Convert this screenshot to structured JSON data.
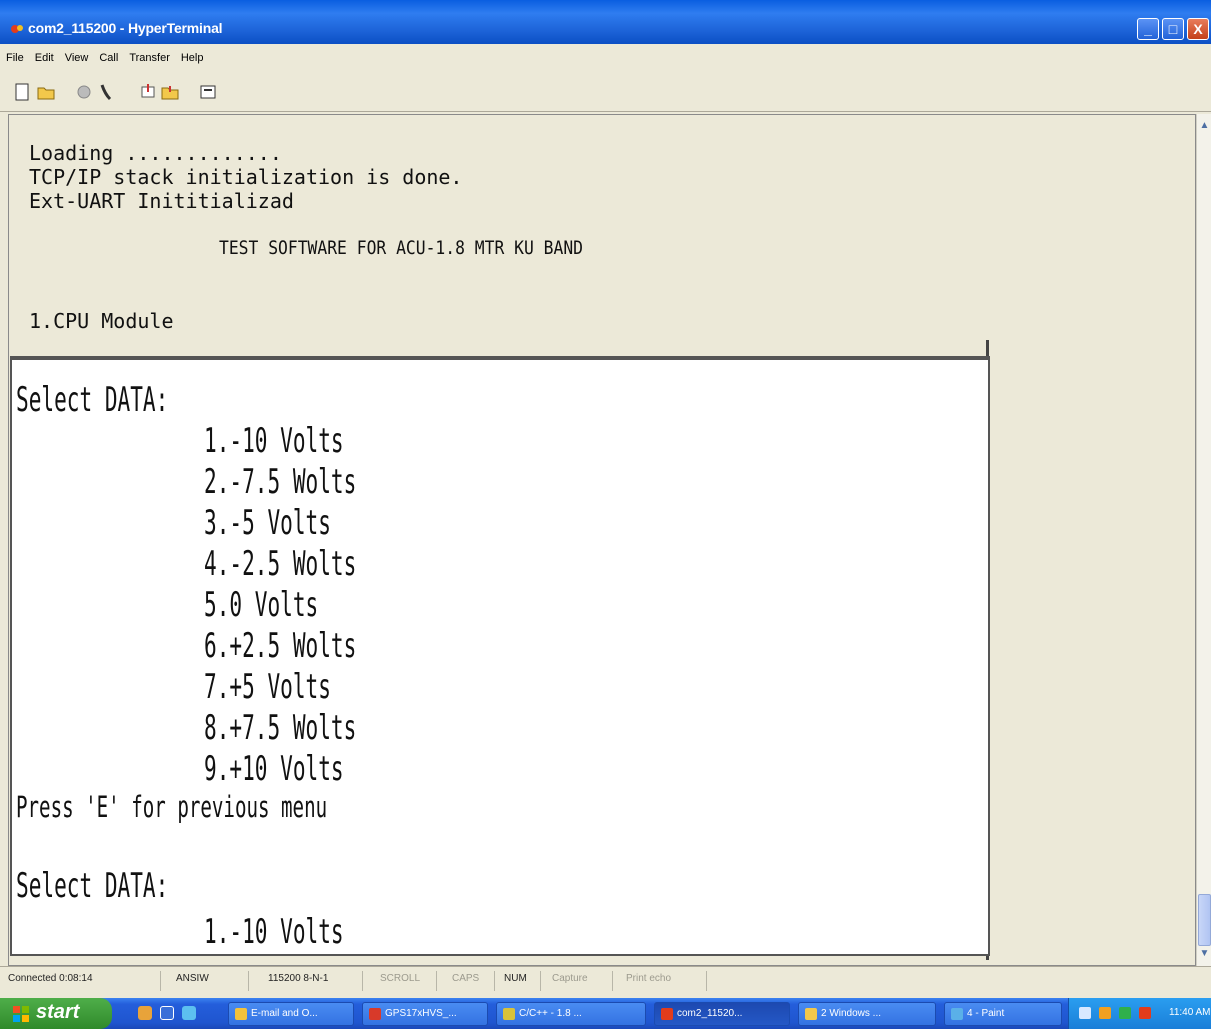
{
  "window": {
    "title": "com2_115200 - HyperTerminal",
    "controls": {
      "minimize": "_",
      "maximize": "□",
      "close": "X"
    }
  },
  "menu": [
    "File",
    "Edit",
    "View",
    "Call",
    "Transfer",
    "Help"
  ],
  "toolbar": {
    "icons": [
      "new-icon",
      "open-icon",
      "disconnect-icon",
      "phone-icon",
      "send-icon",
      "receive-icon",
      "properties-icon"
    ]
  },
  "terminal": {
    "lines": [
      "Loading .............",
      "TCP/IP stack initialization is done.",
      "Ext-UART Inititializad",
      "TEST SOFTWARE FOR ACU-1.8 MTR KU BAND",
      "1.CPU Module"
    ]
  },
  "overlay": {
    "heading_1": "Select DATA:",
    "options": [
      "1.-10 Volts",
      "2.-7.5 Wolts",
      "3.-5 Volts",
      "4.-2.5 Wolts",
      "5.0 Volts",
      "6.+2.5 Wolts",
      "7.+5 Volts",
      "8.+7.5 Wolts",
      "9.+10 Volts"
    ],
    "footer": "Press 'E' for previous menu",
    "heading_2": "Select DATA:",
    "option_repeat": "1.-10 Volts"
  },
  "statusbar": {
    "connected": "Connected 0:08:14",
    "emulation": "ANSIW",
    "settings": "115200 8-N-1",
    "scroll": "SCROLL",
    "caps": "CAPS",
    "num": "NUM",
    "capture": "Capture",
    "print_echo": "Print echo"
  },
  "taskbar": {
    "start": "start",
    "tasks": [
      "E-mail and O...",
      "GPS17xHVS_...",
      "C/C++ - 1.8 ...",
      "com2_11520...",
      "2 Windows ...",
      "4 - Paint"
    ],
    "clock": "11:40 AM"
  },
  "colors": {
    "titlebar": "#0a5ee0",
    "terminal_bg": "#ece9d8",
    "overlay_bg": "#ffffff",
    "taskbar": "#245edb",
    "start_button": "#3c9a36"
  }
}
